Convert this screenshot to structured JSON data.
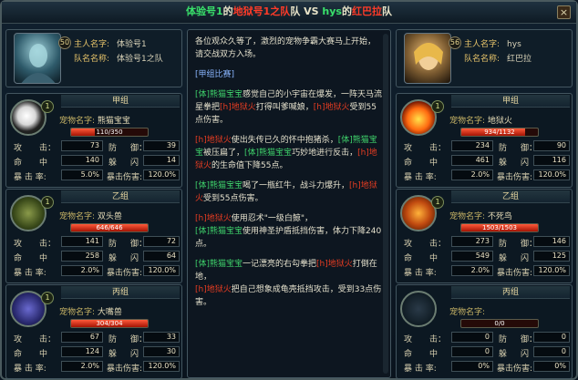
{
  "title": {
    "p1": "体验号1",
    "p2": "的",
    "p3": "地狱号1之队",
    "p4": "队 VS ",
    "p5": "hys",
    "p6": "的",
    "p7": "红巴拉",
    "p8": "队"
  },
  "left": {
    "level": "50",
    "name_label": "主人名字:",
    "name": "体验号1",
    "team_label": "队名名称:",
    "team": "体验号1之队",
    "groups": [
      {
        "head": "甲组",
        "star": "1",
        "pet_label": "宠物名字:",
        "pet": "熊猫宝宝",
        "hp": "110/350",
        "hp_frac": 0.314,
        "atk": "73",
        "def": "39",
        "hit": "140",
        "dodge": "14",
        "crit": "5.0%",
        "critdmg": "120.0%"
      },
      {
        "head": "乙组",
        "star": "1",
        "pet_label": "宠物名字:",
        "pet": "双头兽",
        "hp": "646/646",
        "hp_frac": 1,
        "atk": "141",
        "def": "72",
        "hit": "258",
        "dodge": "64",
        "crit": "2.0%",
        "critdmg": "120.0%"
      },
      {
        "head": "丙组",
        "star": "1",
        "pet_label": "宠物名字:",
        "pet": "大嘴兽",
        "hp": "304/304",
        "hp_frac": 1,
        "atk": "67",
        "def": "33",
        "hit": "124",
        "dodge": "30",
        "crit": "2.0%",
        "critdmg": "120.0%"
      }
    ]
  },
  "right": {
    "level": "56",
    "name_label": "主人名字:",
    "name": "hys",
    "team_label": "队名名称:",
    "team": "红巴拉",
    "groups": [
      {
        "head": "甲组",
        "star": "1",
        "pet_label": "宠物名字:",
        "pet": "地狱火",
        "hp": "934/1132",
        "hp_frac": 0.825,
        "atk": "234",
        "def": "90",
        "hit": "461",
        "dodge": "116",
        "crit": "2.0%",
        "critdmg": "120.0%"
      },
      {
        "head": "乙组",
        "star": "1",
        "pet_label": "宠物名字:",
        "pet": "不死鸟",
        "hp": "1503/1503",
        "hp_frac": 1,
        "atk": "273",
        "def": "146",
        "hit": "549",
        "dodge": "125",
        "crit": "2.0%",
        "critdmg": "120.0%"
      },
      {
        "head": "丙组",
        "star": "",
        "pet_label": "宠物名字:",
        "pet": "",
        "hp": "0/0",
        "hp_frac": 0,
        "atk": "0",
        "def": "0",
        "hit": "0",
        "dodge": "0",
        "crit": "0%",
        "critdmg": "0%"
      }
    ]
  },
  "labels": {
    "atk": "攻",
    "def": "防",
    "hit": "命",
    "dodge": "躲",
    "crit": "暴 击 率:",
    "critdmg": "暴击伤害:",
    "colon": "中",
    "colon2": "闪"
  },
  "log": {
    "intro": "各位观众久等了，激烈的宠物争霸大赛马上开始，请交战双方入场。",
    "section": "[甲组比赛]",
    "l1a": "[体]熊猫宝宝",
    "l1b": "感觉自己的小宇宙在爆发，一阵天马流星拳把",
    "l1c": "[h]地狱火",
    "l1d": "打得叫爹喊娘，",
    "l1e": "[h]地狱火",
    "l1f": "受到55点伤害。",
    "l2a": "[h]地狱火",
    "l2b": "使出失传已久的怀中抱猪杀，",
    "l2c": "[体]熊猫宝宝",
    "l2d": "被压扁了，",
    "l2e": "[体]熊猫宝宝",
    "l2f": "巧妙地进行反击，",
    "l2g": "[h]地狱火",
    "l2h": "的生命值下降55点。",
    "l3a": "[体]熊猫宝宝",
    "l3b": "喝了一瓶红牛，战斗力爆升，",
    "l3c": "[h]地狱火",
    "l3d": "受到55点伤害。",
    "l4a": "[h]地狱火",
    "l4b": "使用忍术\"一级白鲸\"，",
    "l4c": "[体]熊猫宝宝",
    "l4d": "使用神圣护盾抵挡伤害，体力下降240点。",
    "l5a": "[体]熊猫宝宝",
    "l5b": "一记漂亮的右勾拳把",
    "l5c": "[h]地狱火",
    "l5d": "打倒在地，",
    "l5e": "[h]地狱火",
    "l5f": "把自己想象成龟壳抵挡攻击，受到33点伤害。"
  },
  "close": "×"
}
